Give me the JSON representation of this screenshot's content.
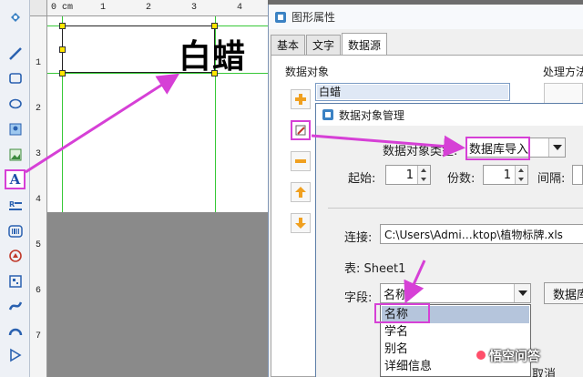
{
  "canvas": {
    "label_text": "白蜡",
    "ruler_top_unit": "0 cm",
    "ruler_top_ticks": [
      "1",
      "2",
      "3",
      "4"
    ],
    "ruler_left_ticks": [
      "1",
      "2",
      "3",
      "4",
      "5",
      "6",
      "7"
    ]
  },
  "properties_dialog": {
    "title": "图形属性",
    "tabs": [
      "基本",
      "文字",
      "数据源"
    ],
    "data_object_label": "数据对象",
    "data_object_item": "白蜡",
    "processing_label": "处理方法"
  },
  "data_manager_dialog": {
    "title": "数据对象管理",
    "type_label": "数据对象类型:",
    "type_value": "数据库导入",
    "start_label": "起始:",
    "start_value": "1",
    "copies_label": "份数:",
    "copies_value": "1",
    "interval_label": "间隔:",
    "connection_label": "连接:",
    "connection_value": "C:\\Users\\Admi…ktop\\植物标牌.xls",
    "table_label": "表:",
    "table_value": "Sheet1",
    "field_label": "字段:",
    "field_value": "名称",
    "field_options": [
      "名称",
      "学名",
      "别名",
      "详细信息"
    ],
    "db_button": "数据库",
    "cancel_button": "取消"
  },
  "watermark": "悟空问答",
  "colors": {
    "highlight": "#d640d6",
    "guide_line": "#37c837",
    "handle": "#ffe600"
  }
}
